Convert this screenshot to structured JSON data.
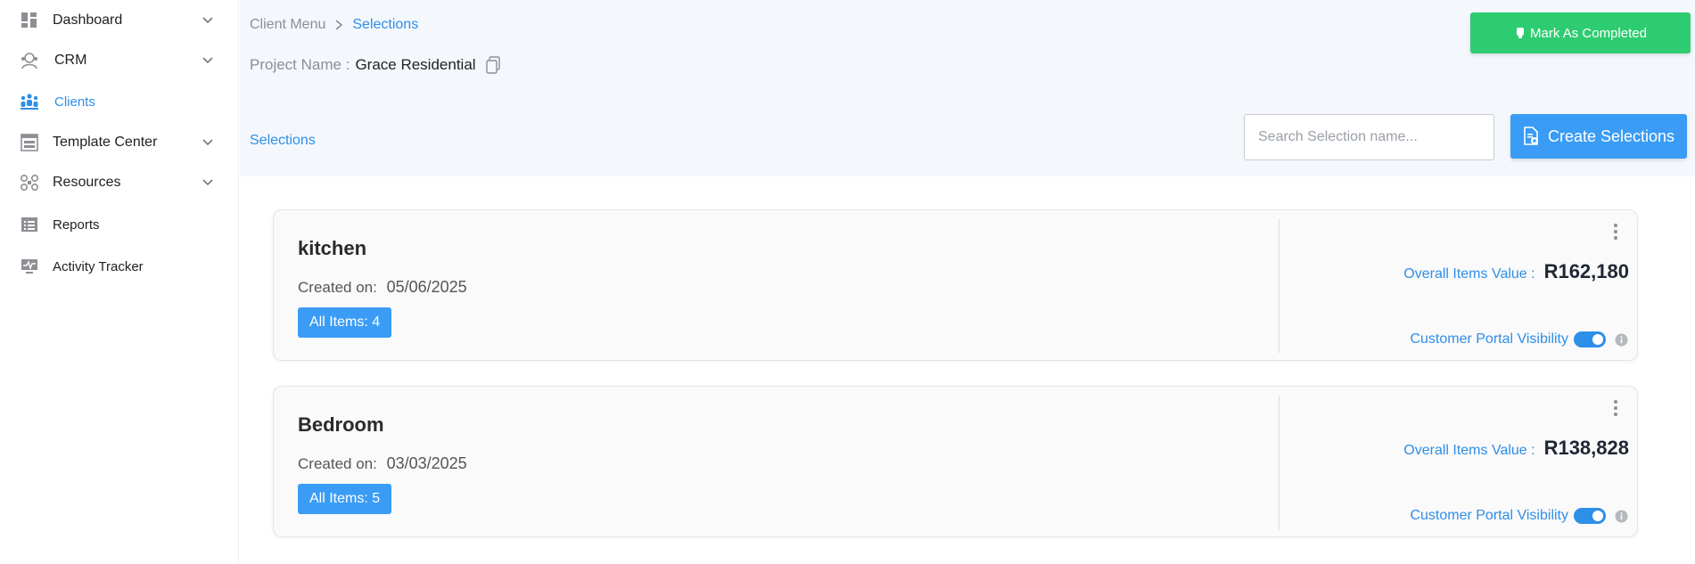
{
  "sidebar": {
    "items": [
      {
        "label": "Dashboard",
        "icon": "dashboard-icon",
        "has_chevron": true
      },
      {
        "label": "CRM",
        "icon": "crm-icon",
        "has_chevron": true
      },
      {
        "label": "Clients",
        "icon": "clients-icon",
        "has_chevron": false,
        "active": true
      },
      {
        "label": "Template Center",
        "icon": "template-icon",
        "has_chevron": true
      },
      {
        "label": "Resources",
        "icon": "resources-icon",
        "has_chevron": true
      },
      {
        "label": "Reports",
        "icon": "reports-icon",
        "has_chevron": false
      },
      {
        "label": "Activity Tracker",
        "icon": "activity-icon",
        "has_chevron": false
      }
    ]
  },
  "breadcrumb": {
    "parent": "Client Menu",
    "current": "Selections"
  },
  "project": {
    "label": "Project Name :",
    "name": "Grace Residential"
  },
  "header": {
    "mark_completed_label": "Mark As Completed",
    "section_title": "Selections",
    "search_placeholder": "Search Selection name...",
    "create_label": "Create Selections"
  },
  "cards": [
    {
      "name": "kitchen",
      "created_label": "Created on:",
      "created_date": "05/06/2025",
      "items_badge": "All Items: 4",
      "overall_label": "Overall Items Value :",
      "overall_value": "R162,180",
      "visibility_label": "Customer Portal Visibility",
      "visibility_on": true
    },
    {
      "name": "Bedroom",
      "created_label": "Created on:",
      "created_date": "03/03/2025",
      "items_badge": "All Items: 5",
      "overall_label": "Overall Items Value :",
      "overall_value": "R138,828",
      "visibility_label": "Customer Portal Visibility",
      "visibility_on": true
    }
  ],
  "colors": {
    "accent": "#2f8ee8",
    "primary_button": "#3a9cf5",
    "success_button": "#2ecc71",
    "header_bg": "#f4f8fd"
  }
}
